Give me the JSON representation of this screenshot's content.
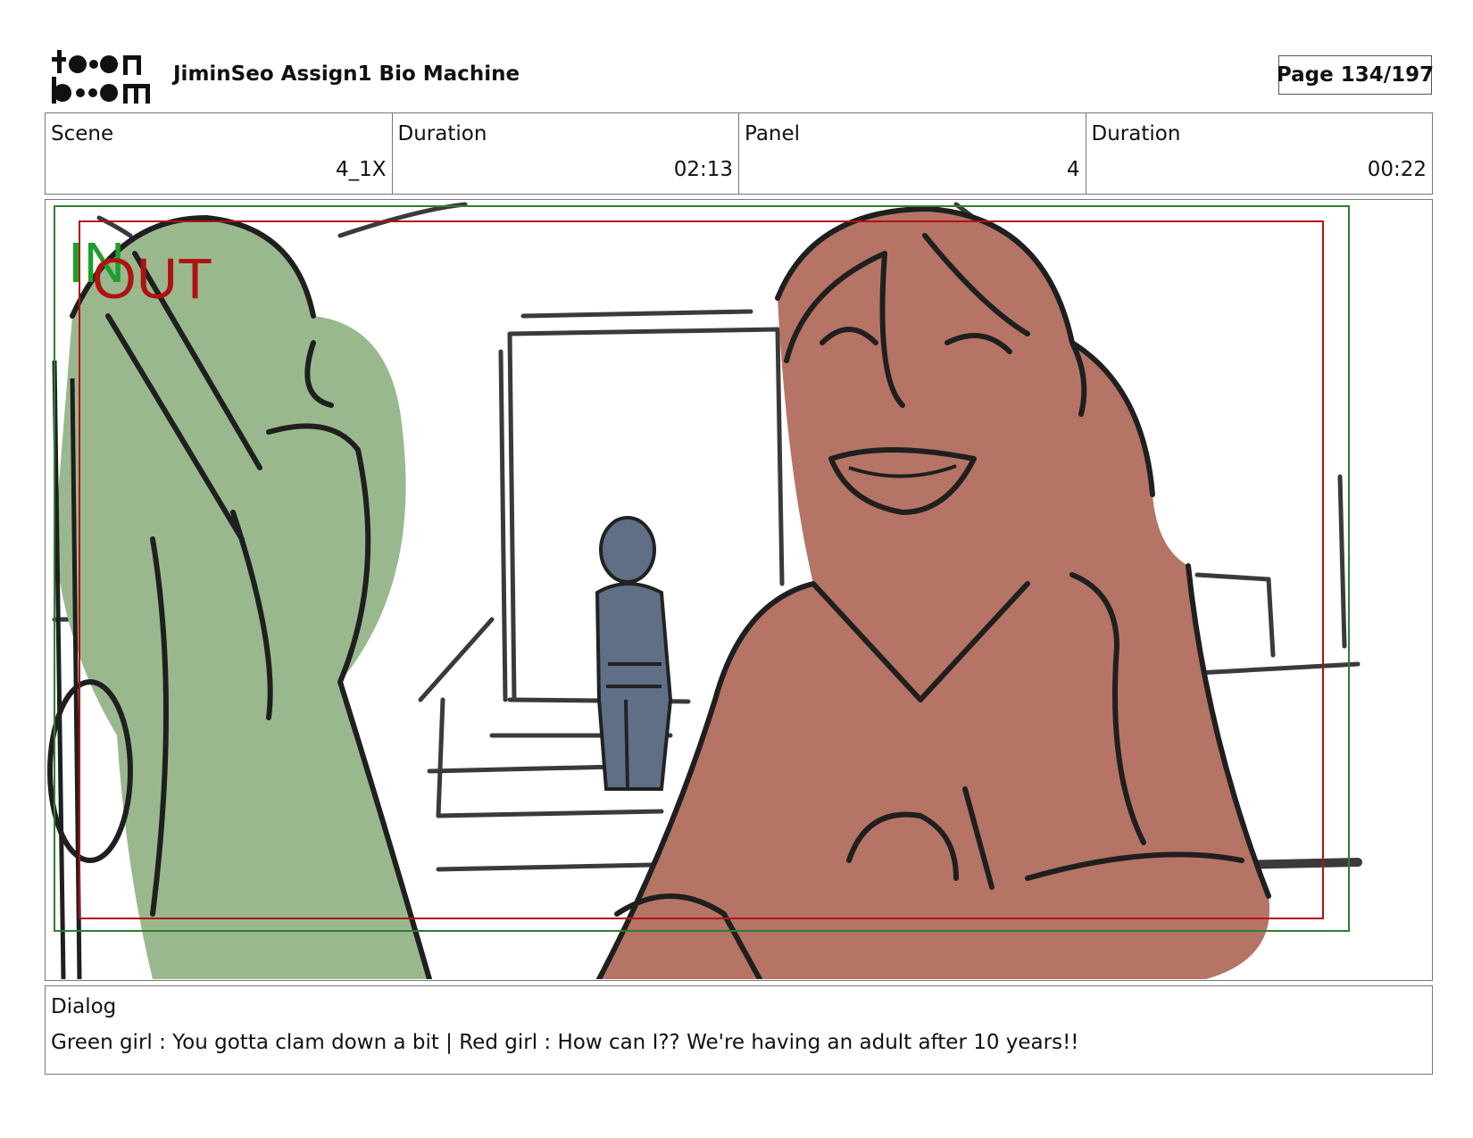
{
  "header": {
    "logo_top": "toon",
    "logo_bottom": "boom",
    "title": "JiminSeo Assign1 Bio Machine",
    "page": "Page 134/197"
  },
  "info": {
    "scene_label": "Scene",
    "scene_value": "4_1X",
    "scene_duration_label": "Duration",
    "scene_duration_value": "02:13",
    "panel_label": "Panel",
    "panel_value": "4",
    "panel_duration_label": "Duration",
    "panel_duration_value": "00:22"
  },
  "panel": {
    "in_label": "IN",
    "out_label": "OUT",
    "in_color": "#1e9e2a",
    "out_color": "#b01212",
    "green_character_color": "#9ab88e",
    "red_character_color": "#b57465",
    "blue_character_color": "#5e6f86"
  },
  "dialog": {
    "label": "Dialog",
    "text": "Green girl : You gotta clam down a bit | Red girl : How can I?? We're having an adult after 10 years!!"
  }
}
